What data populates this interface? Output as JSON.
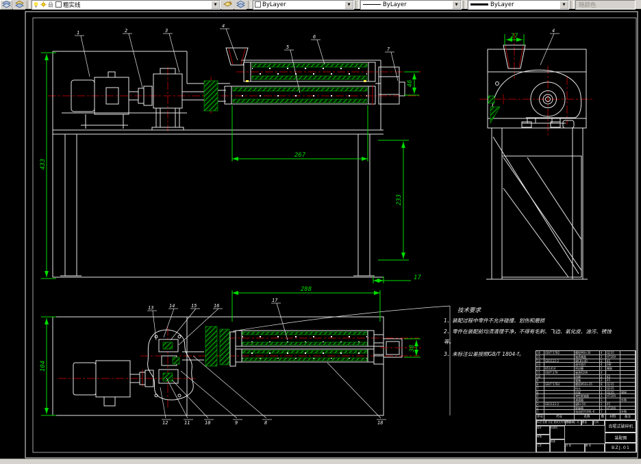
{
  "toolbar": {
    "layer_name": "粗实线",
    "color_value": "ByLayer",
    "linetype_value": "ByLayer",
    "lineweight_value": "ByLayer",
    "plot_style_value": "随颜色",
    "dropdown_glyph": "▼"
  },
  "drawing": {
    "dimensions": {
      "front_height": "433",
      "roller_length": "267",
      "roller_gap": "46",
      "frame_lower_height": "233",
      "foot_offset": "17",
      "plan_length": "288",
      "outlet_width": "38",
      "hopper_width": "27",
      "plan_height": "104"
    },
    "balloons": {
      "front": [
        "1",
        "2",
        "3",
        "4",
        "5",
        "6",
        "7"
      ],
      "side": [
        "4"
      ],
      "plan_top": [
        "13",
        "14",
        "15",
        "16",
        "17"
      ],
      "plan_bottom": [
        "12",
        "11",
        "10",
        "9",
        "8",
        "18"
      ]
    },
    "tech_requirements": {
      "title": "技术要求",
      "line1": "1、装配过程中零件不允许碰撞、划伤和磨损",
      "line2": "2、零件在装配前均须清理干净，不得有毛刺、飞边、氧化皮、油污、锈蚀",
      "line2b": "等。",
      "line3": "3、未标注公差按照GB/T 1804-f。"
    }
  },
  "title_block": {
    "product": "齿辊式破碎机",
    "doc_type": "装配图",
    "drawing_no": "BZJ.01",
    "bom_header": {
      "no": "序号",
      "code": "代号",
      "name": "名称",
      "qty": "数量",
      "mat": "材料",
      "remark": "备注"
    },
    "bom": [
      {
        "no": "16",
        "code": "GB/T 5782",
        "name": "螺栓M8×30",
        "qty": "4",
        "mat": "Q235",
        "remark": ""
      },
      {
        "no": "15",
        "code": "",
        "name": "轴承端盖",
        "qty": "2",
        "mat": "HT200",
        "remark": ""
      },
      {
        "no": "14",
        "code": "GB1122-2",
        "name": "键C8×40",
        "qty": "2",
        "mat": "45",
        "remark": ""
      },
      {
        "no": "13",
        "code": "",
        "name": "调节垫片",
        "qty": "4",
        "mat": "08F",
        "remark": ""
      },
      {
        "no": "12",
        "code": "B51414",
        "name": "密封圈",
        "qty": "2",
        "mat": "橡胶",
        "remark": ""
      },
      {
        "no": "11",
        "code": "GB/T 276",
        "name": "轴承6206",
        "qty": "4",
        "mat": "",
        "remark": ""
      },
      {
        "no": "10",
        "code": "",
        "name": "齿辊",
        "qty": "2",
        "mat": "45",
        "remark": ""
      },
      {
        "no": "9",
        "code": "",
        "name": "辊轴",
        "qty": "2",
        "mat": "45",
        "remark": ""
      },
      {
        "no": "8",
        "code": "GB/T 5783",
        "name": "螺栓M10×35",
        "qty": "8",
        "mat": "Q235",
        "remark": ""
      },
      {
        "no": "7",
        "code": "",
        "name": "料斗",
        "qty": "1",
        "mat": "Q235",
        "remark": ""
      },
      {
        "no": "6",
        "code": "",
        "name": "机架",
        "qty": "1",
        "mat": "Q235",
        "remark": "焊接"
      },
      {
        "no": "5",
        "code": "",
        "name": "弹性联轴器",
        "qty": "1",
        "mat": "HT200",
        "remark": ""
      },
      {
        "no": "4",
        "code": "",
        "name": "减速器",
        "qty": "1",
        "mat": "",
        "remark": "外购"
      },
      {
        "no": "3",
        "code": "GB1122-2",
        "name": "键8×50",
        "qty": "1",
        "mat": "45",
        "remark": ""
      },
      {
        "no": "2",
        "code": "",
        "name": "联轴器",
        "qty": "1",
        "mat": "HT200",
        "remark": ""
      },
      {
        "no": "1",
        "code": "",
        "name": "电动机Y100L-6",
        "qty": "1",
        "mat": "",
        "remark": "外购"
      }
    ],
    "fields": {
      "mark_row": "标记 处数 分区 更改文件号 签名 年、月、日",
      "design": "设计",
      "check": "审核",
      "process": "工艺",
      "standard": "标准化",
      "approve": "批准",
      "stage": "阶段标记",
      "mass": "质量",
      "scale": "比例",
      "sheets": "共 张",
      "page": "第 张"
    }
  }
}
